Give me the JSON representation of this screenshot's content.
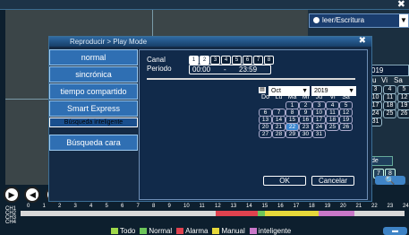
{
  "background": {
    "rw_select": "leer/Escritura",
    "right_calendar": {
      "year": "019",
      "headers": [
        "Ju",
        "Vi",
        "Sa"
      ],
      "rows": [
        [
          "3",
          "4",
          "5"
        ],
        [
          "10",
          "11",
          "12"
        ],
        [
          "17",
          "18",
          "19"
        ],
        [
          "24",
          "25",
          "26"
        ],
        [
          "31",
          "",
          ""
        ]
      ]
    },
    "right_small_label": "de",
    "right_buttons": [
      "7",
      "8"
    ]
  },
  "playback_controls": [
    "play",
    "stop",
    "rewind"
  ],
  "timeline": {
    "hours": [
      "0",
      "1",
      "2",
      "3",
      "4",
      "5",
      "6",
      "7",
      "8",
      "9",
      "10",
      "11",
      "12",
      "13",
      "14",
      "15",
      "16",
      "17",
      "18",
      "19",
      "20",
      "21",
      "22",
      "23",
      "24"
    ],
    "channel_labels": [
      "CH1",
      "CH2",
      "CH3",
      "CH4"
    ]
  },
  "legend": {
    "items": [
      {
        "label": "Todo",
        "color": "#9fd84a"
      },
      {
        "label": "Normal",
        "color": "#6cc55a"
      },
      {
        "label": "Alarma",
        "color": "#e0424f"
      },
      {
        "label": "Manual",
        "color": "#e6d83a"
      },
      {
        "label": "inteligente",
        "color": "#c978c9"
      }
    ]
  },
  "dialog": {
    "title": "Reproducir > Play Mode",
    "menu": [
      "normal",
      "sincrónica",
      "tiempo compartido",
      "Smart Express",
      "Búsqueda inteligente",
      "Búsqueda cara"
    ],
    "selected_menu": "Búsqueda inteligente",
    "canal_label": "Canal",
    "periodo_label": "Periodo",
    "channels": [
      "1",
      "2",
      "3",
      "4",
      "5",
      "6",
      "7",
      "8"
    ],
    "time_from": "00:00",
    "time_sep": "-",
    "time_to": "23:59",
    "calendar": {
      "month": "Oct",
      "year": "2019",
      "day_headers": [
        "Do",
        "Lu",
        "Ma",
        "Mi",
        "Ju",
        "Vi",
        "Sa"
      ],
      "weeks": [
        [
          "",
          "",
          "1",
          "2",
          "3",
          "4",
          "5"
        ],
        [
          "6",
          "7",
          "8",
          "9",
          "10",
          "11",
          "12"
        ],
        [
          "13",
          "14",
          "15",
          "16",
          "17",
          "18",
          "19"
        ],
        [
          "20",
          "21",
          "22",
          "23",
          "24",
          "25",
          "26"
        ],
        [
          "27",
          "28",
          "29",
          "30",
          "31",
          "",
          ""
        ]
      ],
      "today": "22"
    },
    "ok_label": "OK",
    "cancel_label": "Cancelar"
  }
}
